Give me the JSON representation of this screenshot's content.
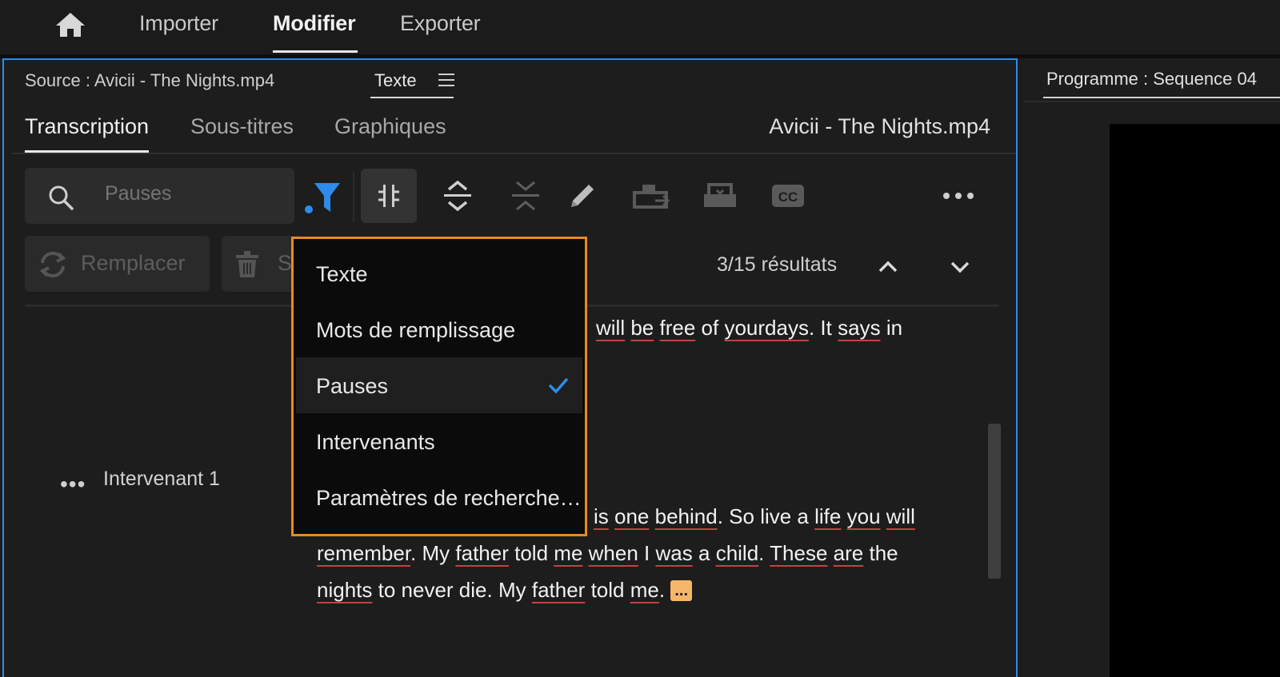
{
  "nav": {
    "home_icon": "home-icon",
    "items": [
      "Importer",
      "Modifier",
      "Exporter"
    ],
    "active": "Modifier"
  },
  "source_panel": {
    "header": "Source : Avicii - The Nights.mp4",
    "tab": "Texte",
    "subtabs": [
      "Transcription",
      "Sous-titres",
      "Graphiques"
    ],
    "active_subtab": "Transcription",
    "filename": "Avicii - The Nights.mp4",
    "search": {
      "value": "",
      "placeholder": "Pauses"
    },
    "toolbar_icons": [
      "filter-icon",
      "split-icon",
      "expand-icon",
      "collapse-icon",
      "pencil-icon",
      "export-icon",
      "import-icon",
      "cc-icon",
      "more-icon"
    ],
    "actions": {
      "replace": "Remplacer",
      "delete": "S"
    },
    "results": "3/15 résultats",
    "speaker": "Intervenant 1",
    "transcript": {
      "line1_words": [
        "will",
        "be",
        "free",
        "of",
        "your",
        "days",
        ". It",
        "says",
        "in"
      ],
      "line2": [
        "is",
        "one",
        "behind",
        ". So live a",
        "life",
        "you",
        "will"
      ],
      "line3": [
        "remember",
        ". My",
        "father",
        "told",
        "me",
        "when",
        "I",
        "was",
        "a",
        "child",
        ".",
        "These",
        "are",
        "the"
      ],
      "line4": [
        "nights",
        "to never die. My",
        "father",
        "told",
        "me",
        "."
      ],
      "pause_marker": "..."
    }
  },
  "program_panel": {
    "title": "Programme : Sequence 04"
  },
  "dropdown": {
    "items": [
      "Texte",
      "Mots de remplissage",
      "Pauses",
      "Intervenants",
      "Paramètres de recherche…"
    ],
    "selected": "Pauses"
  },
  "colors": {
    "accent_blue": "#2d8ceb",
    "dropdown_border": "#ea8a1e",
    "pause_chip": "#f5b66a",
    "underline_red": "#c0443f"
  }
}
